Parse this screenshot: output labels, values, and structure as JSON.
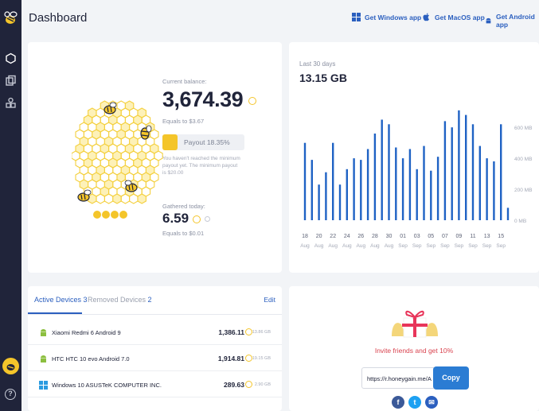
{
  "header": {
    "title": "Dashboard",
    "app_links": [
      {
        "label": "Get Windows app",
        "icon": "windows-icon"
      },
      {
        "label": "Get MacOS app",
        "icon": "apple-icon"
      },
      {
        "label": "Get Android app",
        "icon": "android-icon"
      }
    ]
  },
  "sidebar": {
    "items": [
      {
        "icon": "hexagon-icon"
      },
      {
        "icon": "devices-icon"
      },
      {
        "icon": "shapes-icon"
      }
    ],
    "help_icon": "?"
  },
  "balance": {
    "current_label": "Current balance:",
    "current_value": "3,674.39",
    "equals_text": "Equals to $3.67",
    "payout_label": "Payout 18.35%",
    "payout_progress": 0.1835,
    "payout_note": "You haven't reached the minimum payout yet. The minimum payout is $20.00",
    "today_label": "Gathered today:",
    "today_value": "6.59",
    "today_equals": "Equals to $0.01"
  },
  "chart_data": {
    "type": "bar",
    "subtitle": "Last 30 days",
    "total": "13.15 GB",
    "ylim": [
      0,
      750
    ],
    "yticks": [
      {
        "value": 0,
        "label": "0 MB"
      },
      {
        "value": 200,
        "label": "200 MB"
      },
      {
        "value": 400,
        "label": "400 MB"
      },
      {
        "value": 600,
        "label": "600 MB"
      }
    ],
    "values": [
      500,
      390,
      230,
      310,
      500,
      230,
      330,
      400,
      390,
      460,
      560,
      650,
      620,
      470,
      400,
      460,
      330,
      480,
      320,
      410,
      640,
      600,
      710,
      680,
      620,
      480,
      400,
      380,
      620,
      80
    ],
    "tick_labels": [
      {
        "day": "18",
        "mon": "Aug"
      },
      {
        "day": "20",
        "mon": "Aug"
      },
      {
        "day": "22",
        "mon": "Aug"
      },
      {
        "day": "24",
        "mon": "Aug"
      },
      {
        "day": "26",
        "mon": "Aug"
      },
      {
        "day": "28",
        "mon": "Aug"
      },
      {
        "day": "30",
        "mon": "Aug"
      },
      {
        "day": "01",
        "mon": "Sep"
      },
      {
        "day": "03",
        "mon": "Sep"
      },
      {
        "day": "05",
        "mon": "Sep"
      },
      {
        "day": "07",
        "mon": "Sep"
      },
      {
        "day": "09",
        "mon": "Sep"
      },
      {
        "day": "11",
        "mon": "Sep"
      },
      {
        "day": "13",
        "mon": "Sep"
      },
      {
        "day": "15",
        "mon": "Sep"
      }
    ],
    "color": "#1f62c4",
    "grid": false
  },
  "devices": {
    "active_tab": "Active Devices",
    "active_count": "3",
    "removed_tab": "Removed Devices",
    "removed_count": "2",
    "edit_label": "Edit",
    "rows": [
      {
        "name": "Xiaomi Redmi 6 Android 9",
        "amount": "1,386.11",
        "size": "13.86 GB",
        "icon": "android-icon"
      },
      {
        "name": "HTC HTC 10 evo Android 7.0",
        "amount": "1,914.81",
        "size": "19.15 GB",
        "icon": "android-icon"
      },
      {
        "name": "Windows 10 ASUSTeK COMPUTER INC.",
        "amount": "289.63",
        "size": "2.90 GB",
        "icon": "windows-icon"
      }
    ]
  },
  "invite": {
    "text": "Invite friends and get 10%",
    "link_value": "https://r.honeygain.me/A",
    "copy_label": "Copy",
    "social": [
      "f",
      "t",
      "✉"
    ]
  },
  "colors": {
    "accent": "#2b5fbf",
    "bar": "#1f62c4",
    "honey": "#f4c52a",
    "sidebar": "#20243a",
    "invite": "#d9434f"
  }
}
